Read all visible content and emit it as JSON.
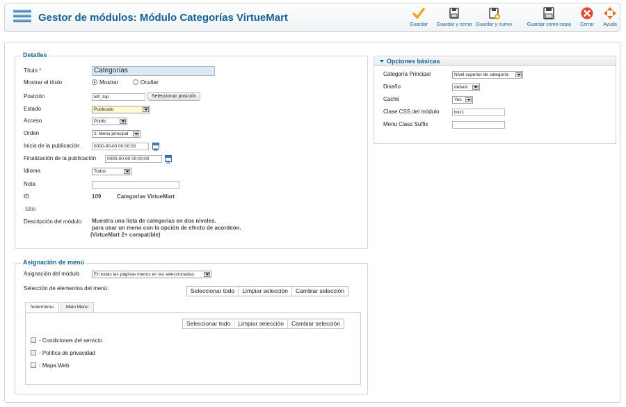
{
  "header": {
    "title": "Gestor de módulos: Módulo Categorías VirtueMart"
  },
  "toolbar": {
    "buttons": [
      {
        "label": "Guardar",
        "icon": "check-icon"
      },
      {
        "label": "Guardar y cerrar",
        "icon": "save-close-icon"
      },
      {
        "label": "Guardar y nuevo",
        "icon": "save-new-icon"
      },
      {
        "label": "Guardar como copia",
        "icon": "save-copy-icon"
      },
      {
        "label": "Cerrar",
        "icon": "close-icon"
      },
      {
        "label": "Ayuda",
        "icon": "help-icon"
      }
    ],
    "colors": {
      "accent": "#146295",
      "check": "#f2a51c",
      "close": "#e04a2f",
      "help": "#e76f1e"
    }
  },
  "details": {
    "legend": "Detalles",
    "title_label": "Título",
    "required_mark": "*",
    "title_value": "Categorías",
    "show_title_label": "Mostrar el título",
    "show_option": "Mostrar",
    "hide_option": "Ocultar",
    "position_label": "Posición",
    "position_value": "left_top",
    "select_position_button": "Seleccionar posición",
    "status_label": "Estado",
    "status_value": "Publicado",
    "access_label": "Acceso",
    "access_value": "Public",
    "order_label": "Orden",
    "order_value": "2. Menu principal",
    "publish_up_label": "Inicio de la publicación",
    "publish_up_value": "0000-00-00 00:00:00",
    "publish_down_label": "Finalización de la publicación",
    "publish_down_value": "0000-00-00 00:00:00",
    "language_label": "Idioma",
    "language_value": "Todos",
    "note_label": "Nota",
    "note_value": "",
    "id_label": "ID",
    "id_value": "109",
    "module_name": "Categorias VirtueMart",
    "site_label": "Sitio",
    "description_label": "Descripción del módulo",
    "description_lines": [
      "Muestra una lista de categorias en dos niveles.",
      "para usar un meno con la opción de efecto de acordeon.",
      "(VirtueMart 2+ compatible)"
    ]
  },
  "menu_assignment": {
    "legend": "Asignación de menú",
    "module_assignment_label": "Asignación del módulo",
    "module_assignment_value": "En todas las páginas menos en las seleccionadas",
    "selection_label": "Selección de elementos del menú:",
    "select_all": "Seleccionar todo",
    "clear_selection": "Limpiar selección",
    "toggle_selection": "Cambiar selección",
    "tabs": [
      "footermenu",
      "Main Menu"
    ],
    "items": [
      "- Condiciones del servicio",
      "- Política de privacidad",
      "- Mapa Web"
    ]
  },
  "basic_options": {
    "title": "Opciones básicas",
    "main_category_label": "Categoría Principal",
    "main_category_value": "Nivel superior de categoría",
    "layout_label": "Diseño",
    "layout_value": "default",
    "cache_label": "Caché",
    "cache_value": "Yes",
    "css_class_label": "Clase CSS del módulo",
    "css_class_value": "box1",
    "menu_suffix_label": "Menu Class Suffix",
    "menu_suffix_value": ""
  }
}
